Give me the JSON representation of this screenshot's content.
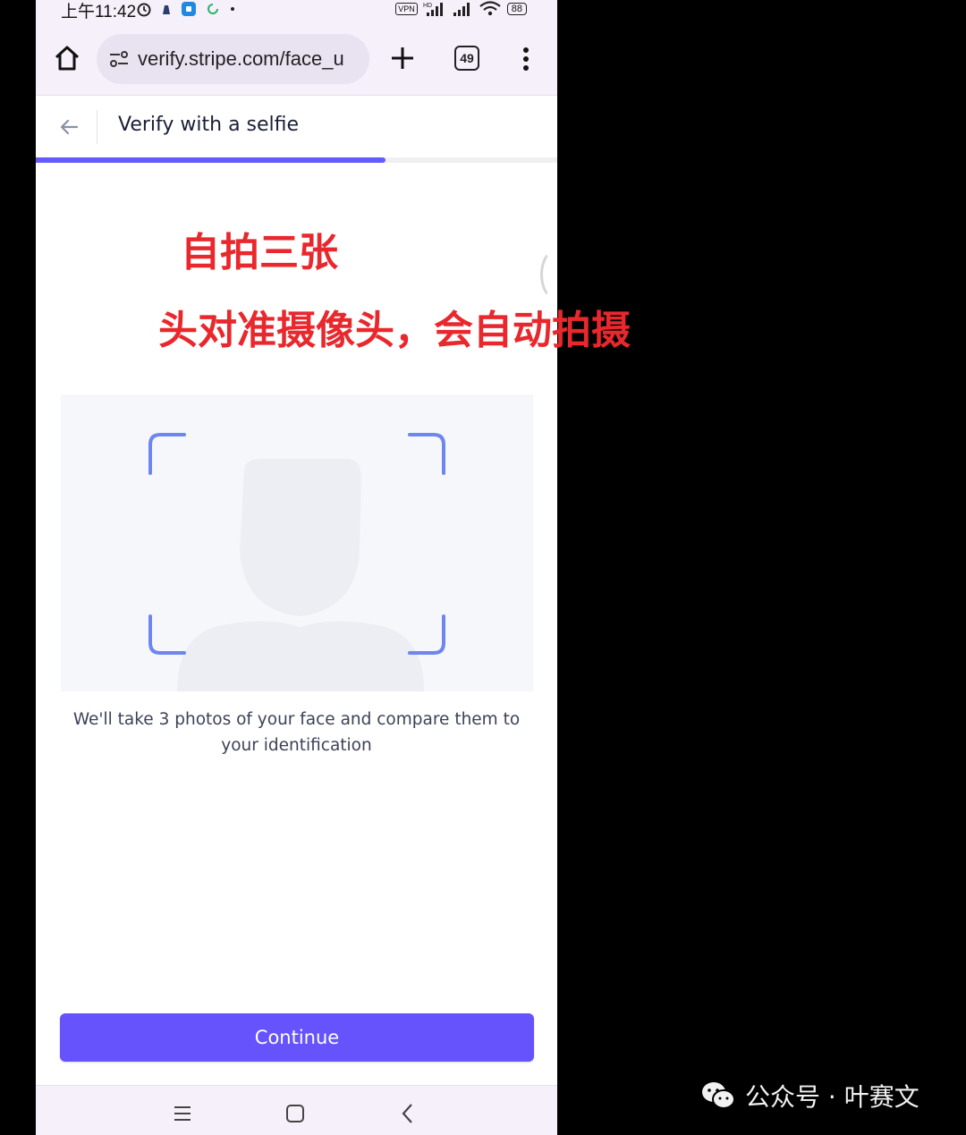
{
  "status_bar": {
    "time": "上午11:42",
    "vpn": "VPN",
    "network": "HD",
    "battery": "88"
  },
  "browser": {
    "url": "verify.stripe.com/face_u",
    "tab_count": "49"
  },
  "page": {
    "title": "Verify with a selfie",
    "progress_fraction": 0.67,
    "description": "We'll take 3 photos of your face and compare them to your identification",
    "continue_label": "Continue"
  },
  "annotations": {
    "line1": "自拍三张",
    "line2": "头对准摄像头，会自动拍摄"
  },
  "watermark": {
    "text": "公众号 · 叶赛文"
  },
  "colors": {
    "accent": "#635bff",
    "button": "#6653fb",
    "frame": "#6e86ee",
    "annotation": "#e8282d"
  }
}
